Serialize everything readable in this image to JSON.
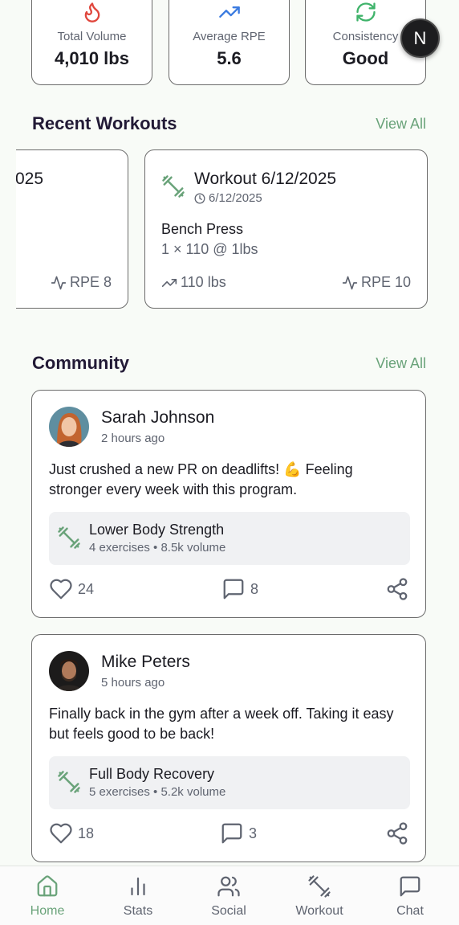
{
  "stats": [
    {
      "icon": "flame-icon",
      "label": "Total Volume",
      "value": "4,010 lbs",
      "color": "#e0463c"
    },
    {
      "icon": "trending-up-icon",
      "label": "Average RPE",
      "value": "5.6",
      "color": "#3b7be0"
    },
    {
      "icon": "refresh-icon",
      "label": "Consistency",
      "value": "Good",
      "color": "#3fb36a"
    }
  ],
  "profile_avatar": {
    "initial": "N"
  },
  "recent_workouts": {
    "title": "Recent Workouts",
    "view_all": "View All",
    "cards": [
      {
        "title_fragment": "025",
        "rpe": "RPE 8"
      },
      {
        "title": "Workout 6/12/2025",
        "date": "6/12/2025",
        "exercise": "Bench Press",
        "sets": "1 × 110 @ 1lbs",
        "volume": "110 lbs",
        "rpe": "RPE 10"
      }
    ]
  },
  "community": {
    "title": "Community",
    "view_all": "View All",
    "posts": [
      {
        "name": "Sarah Johnson",
        "time": "2 hours ago",
        "text": "Just crushed a new PR on deadlifts! 💪 Feeling stronger every week with this program.",
        "workout_name": "Lower Body Strength",
        "workout_meta": "4 exercises • 8.5k volume",
        "likes": "24",
        "comments": "8"
      },
      {
        "name": "Mike Peters",
        "time": "5 hours ago",
        "text": "Finally back in the gym after a week off. Taking it easy but feels good to be back!",
        "workout_name": "Full Body Recovery",
        "workout_meta": "5 exercises • 5.2k volume",
        "likes": "18",
        "comments": "3"
      }
    ]
  },
  "nav": [
    {
      "label": "Home",
      "icon": "home-icon",
      "active": true
    },
    {
      "label": "Stats",
      "icon": "bar-chart-icon",
      "active": false
    },
    {
      "label": "Social",
      "icon": "users-icon",
      "active": false
    },
    {
      "label": "Workout",
      "icon": "dumbbell-icon",
      "active": false
    },
    {
      "label": "Chat",
      "icon": "chat-icon",
      "active": false
    }
  ],
  "colors": {
    "accent": "#6aa37a",
    "background": "#f8fbf7",
    "text": "#221a36"
  }
}
